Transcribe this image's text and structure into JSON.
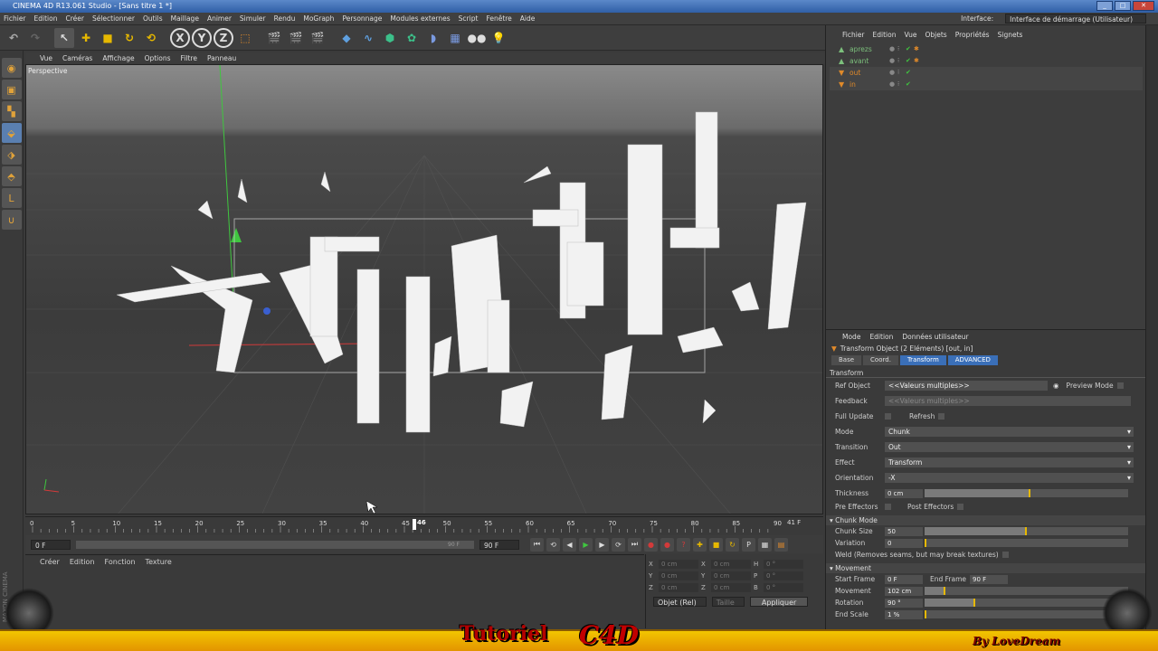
{
  "window": {
    "title": "CINEMA 4D R13.061 Studio - [Sans titre 1 *]"
  },
  "menubar": {
    "items": [
      "Fichier",
      "Edition",
      "Créer",
      "Sélectionner",
      "Outils",
      "Maillage",
      "Animer",
      "Simuler",
      "Rendu",
      "MoGraph",
      "Personnage",
      "Modules externes",
      "Script",
      "Fenêtre",
      "Aide"
    ],
    "interface_label": "Interface:",
    "interface_value": "Interface de démarrage (Utilisateur)"
  },
  "viewport": {
    "menu": [
      "Vue",
      "Caméras",
      "Affichage",
      "Options",
      "Filtre",
      "Panneau"
    ],
    "label": "Perspective"
  },
  "timeline": {
    "ticks": [
      "0",
      "5",
      "10",
      "15",
      "20",
      "25",
      "30",
      "35",
      "40",
      "45",
      "50",
      "55",
      "60",
      "65",
      "70",
      "75",
      "80",
      "85",
      "90"
    ],
    "current": "46",
    "end_label": "41 F",
    "start_field": "0 F",
    "end_field": "90 F",
    "range_end": "90 F"
  },
  "materials": {
    "menu": [
      "Créer",
      "Edition",
      "Fonction",
      "Texture"
    ]
  },
  "coords": {
    "rows": [
      {
        "a": "X",
        "v1": "0 cm",
        "b": "X",
        "v2": "0 cm",
        "c": "H",
        "v3": "0 °"
      },
      {
        "a": "Y",
        "v1": "0 cm",
        "b": "Y",
        "v2": "0 cm",
        "c": "P",
        "v3": "0 °"
      },
      {
        "a": "Z",
        "v1": "0 cm",
        "b": "Z",
        "v2": "0 cm",
        "c": "B",
        "v3": "0 °"
      }
    ],
    "mode": "Objet (Rel)",
    "size": "Taille",
    "apply": "Appliquer"
  },
  "objects": {
    "menu": [
      "Fichier",
      "Edition",
      "Vue",
      "Objets",
      "Propriétés",
      "Signets"
    ],
    "items": [
      {
        "name": "aprezs",
        "color": "#7cc07c"
      },
      {
        "name": "avant",
        "color": "#7cc07c"
      },
      {
        "name": "out",
        "color": "#e08a2a"
      },
      {
        "name": "in",
        "color": "#e08a2a"
      }
    ]
  },
  "attributes": {
    "menu": [
      "Mode",
      "Edition",
      "Données utilisateur"
    ],
    "title": "Transform Object (2 Eléments) [out, in]",
    "tabs": [
      "Base",
      "Coord.",
      "Transform",
      "ADVANCED"
    ],
    "section_transform": "Transform",
    "ref_object_label": "Ref Object",
    "ref_object_value": "<<Valeurs multiples>>",
    "preview_mode": "Preview Mode",
    "feedback_label": "Feedback",
    "feedback_value": "<<Valeurs multiples>>",
    "full_update": "Full Update",
    "refresh": "Refresh",
    "mode_label": "Mode",
    "mode_value": "Chunk",
    "transition_label": "Transition",
    "transition_value": "Out",
    "effect_label": "Effect",
    "effect_value": "Transform",
    "orientation_label": "Orientation",
    "orientation_value": "-X",
    "thickness_label": "Thickness",
    "thickness_value": "0 cm",
    "pre_effectors": "Pre Effectors",
    "post_effectors": "Post Effectors",
    "section_chunk": "Chunk Mode",
    "chunk_size_label": "Chunk Size",
    "chunk_size_value": "50",
    "variation_label": "Variation",
    "variation_value": "0",
    "weld": "Weld (Removes seams, but may break textures)",
    "section_movement": "Movement",
    "start_frame_label": "Start Frame",
    "start_frame_value": "0 F",
    "end_frame_label": "End Frame",
    "end_frame_value": "90 F",
    "movement_label": "Movement",
    "movement_value": "102 cm",
    "rotation_label": "Rotation",
    "rotation_value": "90 °",
    "endscale_label": "End Scale",
    "endscale_value": "1 %"
  },
  "banner": {
    "text1": "Tutoriel",
    "text2": "C4D",
    "text3": "By LoveDream"
  },
  "maxon": "MAXON CINEMA 4D"
}
